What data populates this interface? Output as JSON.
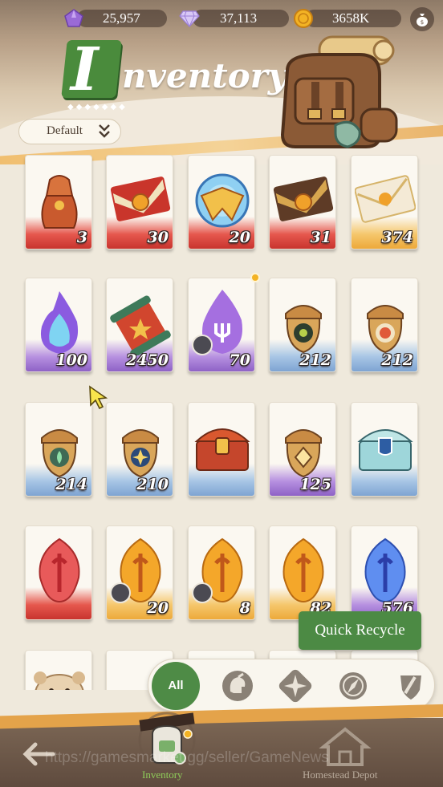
{
  "resources": {
    "crystals": {
      "value": "25,957",
      "icon": "purple-crystal-icon",
      "color": "#9a6ad6"
    },
    "diamonds": {
      "value": "37,113",
      "icon": "diamond-icon",
      "color": "#c9b6f0"
    },
    "coins": {
      "value": "3658K",
      "icon": "gold-coin-icon",
      "color": "#f3b324"
    }
  },
  "title": {
    "initial": "I",
    "rest": "nventory"
  },
  "sort": {
    "label": "Default"
  },
  "items": [
    {
      "qty": "3",
      "rarity": "red",
      "kind": "pouch"
    },
    {
      "qty": "30",
      "rarity": "red",
      "kind": "envelope-red"
    },
    {
      "qty": "20",
      "rarity": "red",
      "kind": "orb"
    },
    {
      "qty": "31",
      "rarity": "red",
      "kind": "envelope-brown"
    },
    {
      "qty": "374",
      "rarity": "gold",
      "kind": "envelope-white"
    },
    {
      "qty": "100",
      "rarity": "purple",
      "kind": "flame-purple"
    },
    {
      "qty": "2450",
      "rarity": "purple",
      "kind": "scroll"
    },
    {
      "qty": "70",
      "rarity": "purple",
      "kind": "flame-trident",
      "tag": true,
      "badge": true
    },
    {
      "qty": "212",
      "rarity": "blue",
      "kind": "acorn-eye"
    },
    {
      "qty": "212",
      "rarity": "blue",
      "kind": "acorn-target"
    },
    {
      "qty": "214",
      "rarity": "blue",
      "kind": "acorn-leaf"
    },
    {
      "qty": "210",
      "rarity": "blue",
      "kind": "acorn-star"
    },
    {
      "qty": "",
      "rarity": "blue",
      "kind": "chest-red"
    },
    {
      "qty": "125",
      "rarity": "purple",
      "kind": "acorn-diamond"
    },
    {
      "qty": "",
      "rarity": "blue",
      "kind": "chest-blue"
    },
    {
      "qty": "",
      "rarity": "red",
      "kind": "gem-red"
    },
    {
      "qty": "20",
      "rarity": "gold",
      "kind": "gem-gold",
      "tag": true
    },
    {
      "qty": "8",
      "rarity": "gold",
      "kind": "gem-gold",
      "tag": true
    },
    {
      "qty": "82",
      "rarity": "gold",
      "kind": "gem-gold"
    },
    {
      "qty": "576",
      "rarity": "purple",
      "kind": "gem-blue"
    },
    {
      "qty": "",
      "rarity": "none",
      "kind": "hamster"
    },
    {
      "qty": "",
      "rarity": "none",
      "kind": "blank"
    },
    {
      "qty": "",
      "rarity": "none",
      "kind": "blank"
    },
    {
      "qty": "",
      "rarity": "none",
      "kind": "blank"
    },
    {
      "qty": "",
      "rarity": "none",
      "kind": "blank"
    }
  ],
  "quick_recycle": {
    "label": "Quick Recycle"
  },
  "filters": {
    "all_label": "All",
    "icons": [
      "helmet-filter-icon",
      "compass-star-filter-icon",
      "compass-filter-icon",
      "shield-sword-filter-icon"
    ]
  },
  "nav": {
    "inventory_label": "Inventory",
    "depot_label": "Homestead Depot",
    "active_color": "#8fce5a",
    "inactive_color": "#b8aa9b"
  },
  "watermark": "https://gamesmarket.gg/seller/GameNews"
}
